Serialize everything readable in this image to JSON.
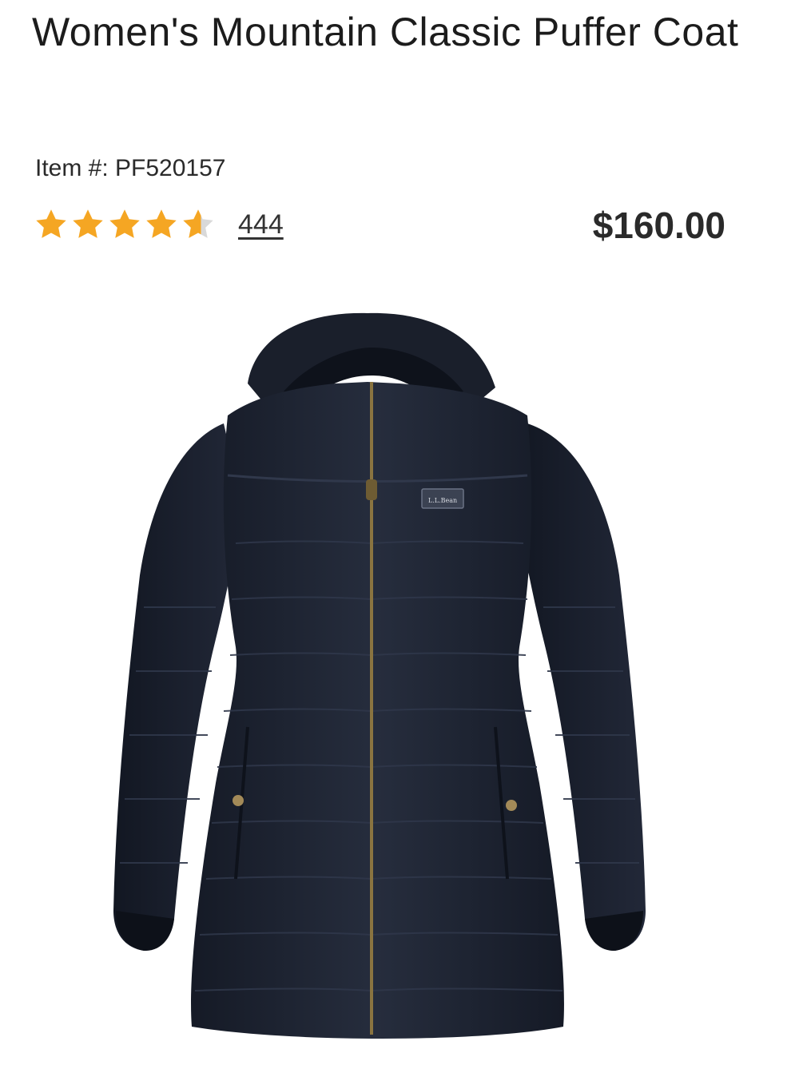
{
  "product": {
    "title": "Women's Mountain Classic Puffer Coat",
    "item_number": "Item #: PF520157",
    "rating": 4.6,
    "rating_max": 5,
    "review_count": "444",
    "price": "$160.00",
    "image": {
      "label_text": "L.L.Bean",
      "color": "#1e2433"
    }
  },
  "colors": {
    "star_filled": "#f5a623",
    "star_empty": "#d9d9d9",
    "text": "#1f1f1f"
  }
}
